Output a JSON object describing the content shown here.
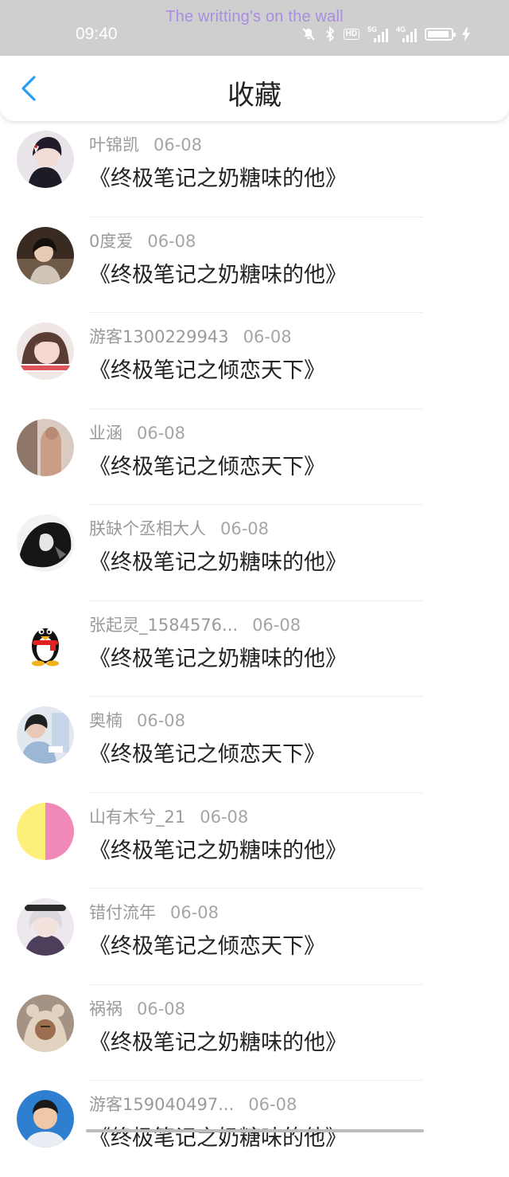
{
  "status_bar": {
    "banner": "The writting's on the wall",
    "time": "09:40",
    "hd_label": "HD",
    "net1_label": "5G",
    "net2_label": "4G"
  },
  "header": {
    "title": "收藏"
  },
  "favorites": [
    {
      "user": "叶锦凯",
      "date": "06-08",
      "book": "《终极笔记之奶糖味的他》",
      "avatar": "anime-boy-mask"
    },
    {
      "user": "0度爱",
      "date": "06-08",
      "book": "《终极笔记之奶糖味的他》",
      "avatar": "girl-dark-hair"
    },
    {
      "user": "游客1300229943",
      "date": "06-08",
      "book": "《终极笔记之倾恋天下》",
      "avatar": "girl-red-caption"
    },
    {
      "user": "业涵",
      "date": "06-08",
      "book": "《终极笔记之倾恋天下》",
      "avatar": "figure-beige"
    },
    {
      "user": "朕缺个丞相大人",
      "date": "06-08",
      "book": "《终极笔记之奶糖味的他》",
      "avatar": "black-white-anime"
    },
    {
      "user": "张起灵_1584576...",
      "date": "06-08",
      "book": "《终极笔记之奶糖味的他》",
      "avatar": "qq-penguin"
    },
    {
      "user": "奥楠",
      "date": "06-08",
      "book": "《终极笔记之倾恋天下》",
      "avatar": "girl-lab"
    },
    {
      "user": "山有木兮_21",
      "date": "06-08",
      "book": "《终极笔记之奶糖味的他》",
      "avatar": "yellow-pink-split"
    },
    {
      "user": "错付流年",
      "date": "06-08",
      "book": "《终极笔记之倾恋天下》",
      "avatar": "anime-white-hair"
    },
    {
      "user": "祸祸",
      "date": "06-08",
      "book": "《终极笔记之奶糖味的他》",
      "avatar": "bear-hood"
    },
    {
      "user": "游客159040497...",
      "date": "06-08",
      "book": "《终极笔记之奶糖味的他》",
      "avatar": "boy-blue"
    }
  ]
}
